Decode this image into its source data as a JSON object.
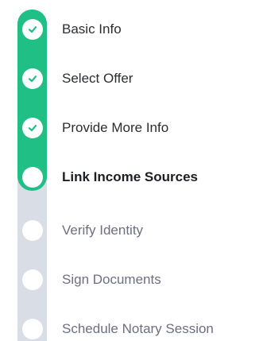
{
  "colors": {
    "accent": "#1fbf86",
    "track": "#d8dde6",
    "dot": "#ffffff",
    "text_done": "#2b2d33",
    "text_current": "#1c1e24",
    "text_todo": "#6b7080"
  },
  "progress": {
    "completed_steps": 3,
    "current_step": 4,
    "total_steps": 7
  },
  "steps": [
    {
      "label": "Basic Info",
      "status": "complete",
      "icon": "check-icon"
    },
    {
      "label": "Select Offer",
      "status": "complete",
      "icon": "check-icon"
    },
    {
      "label": "Provide More Info",
      "status": "complete",
      "icon": "check-icon"
    },
    {
      "label": "Link Income Sources",
      "status": "current",
      "icon": "current-step-dot-icon"
    },
    {
      "label": "Verify Identity",
      "status": "upcoming",
      "icon": "step-dot-icon"
    },
    {
      "label": "Sign Documents",
      "status": "upcoming",
      "icon": "step-dot-icon"
    },
    {
      "label": "Schedule Notary Session",
      "status": "upcoming",
      "icon": "step-dot-icon"
    }
  ]
}
